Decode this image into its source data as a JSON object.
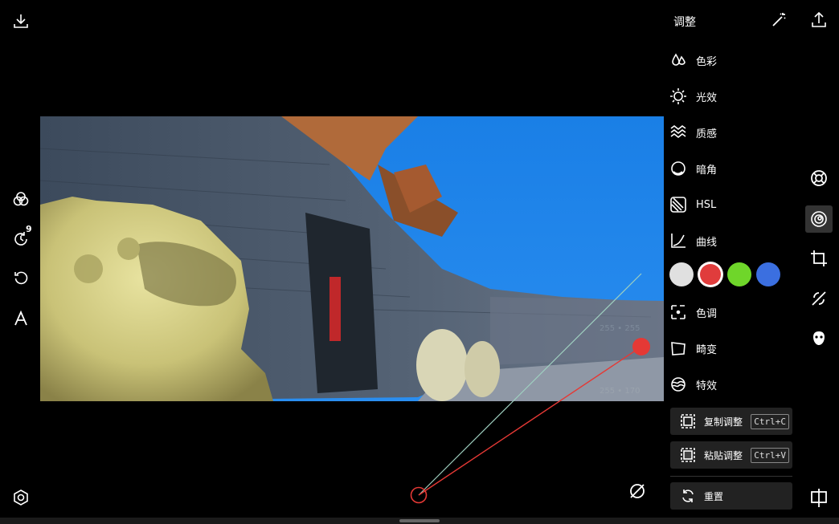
{
  "panel": {
    "title": "调整",
    "menu": [
      {
        "label": "色彩",
        "icon": "drops-icon"
      },
      {
        "label": "光效",
        "icon": "sun-icon"
      },
      {
        "label": "质感",
        "icon": "waves-icon"
      },
      {
        "label": "暗角",
        "icon": "vignette-icon"
      },
      {
        "label": "HSL",
        "icon": "hsl-icon"
      },
      {
        "label": "曲线",
        "icon": "curve-icon"
      }
    ],
    "menu2": [
      {
        "label": "色调",
        "icon": "tone-icon"
      },
      {
        "label": "畸变",
        "icon": "distort-icon"
      },
      {
        "label": "特效",
        "icon": "effects-icon"
      }
    ],
    "swatches": [
      "#e0e0e0",
      "#e03c3c",
      "#6fd62a",
      "#3b6fe0"
    ],
    "copy": {
      "label": "复制调整",
      "shortcut": "Ctrl+C"
    },
    "paste": {
      "label": "粘贴调整",
      "shortcut": "Ctrl+V"
    },
    "reset": {
      "label": "重置"
    }
  },
  "curve": {
    "top_readout": "255 • 255",
    "bottom_readout": "255 • 170"
  },
  "history_badge": "9",
  "colors": {
    "accent": "#e53935",
    "panel_btn": "#222222"
  }
}
